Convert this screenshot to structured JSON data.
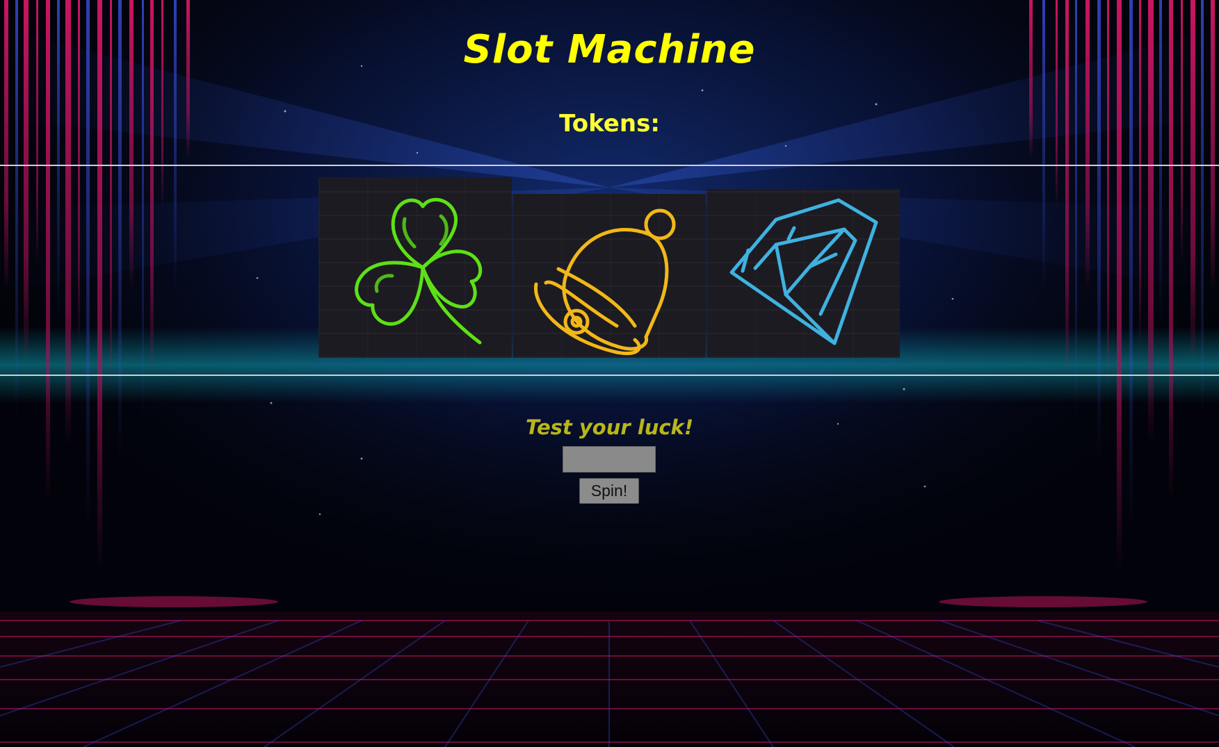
{
  "title": "Slot Machine",
  "tokens_label": "Tokens:",
  "reels": [
    {
      "symbol": "clover-icon",
      "color": "#5ee016"
    },
    {
      "symbol": "bell-icon",
      "color": "#f2b818"
    },
    {
      "symbol": "diamond-icon",
      "color": "#3fb2e0"
    }
  ],
  "prompt": "Test your luck!",
  "bet_input": {
    "value": "",
    "placeholder": ""
  },
  "spin_button": "Spin!",
  "colors": {
    "title": "#ffff00",
    "prompt": "#b9b61a",
    "divider": "#cfcfd6",
    "neon_pink": "#e0186a",
    "neon_blue": "#1f4fd8"
  }
}
